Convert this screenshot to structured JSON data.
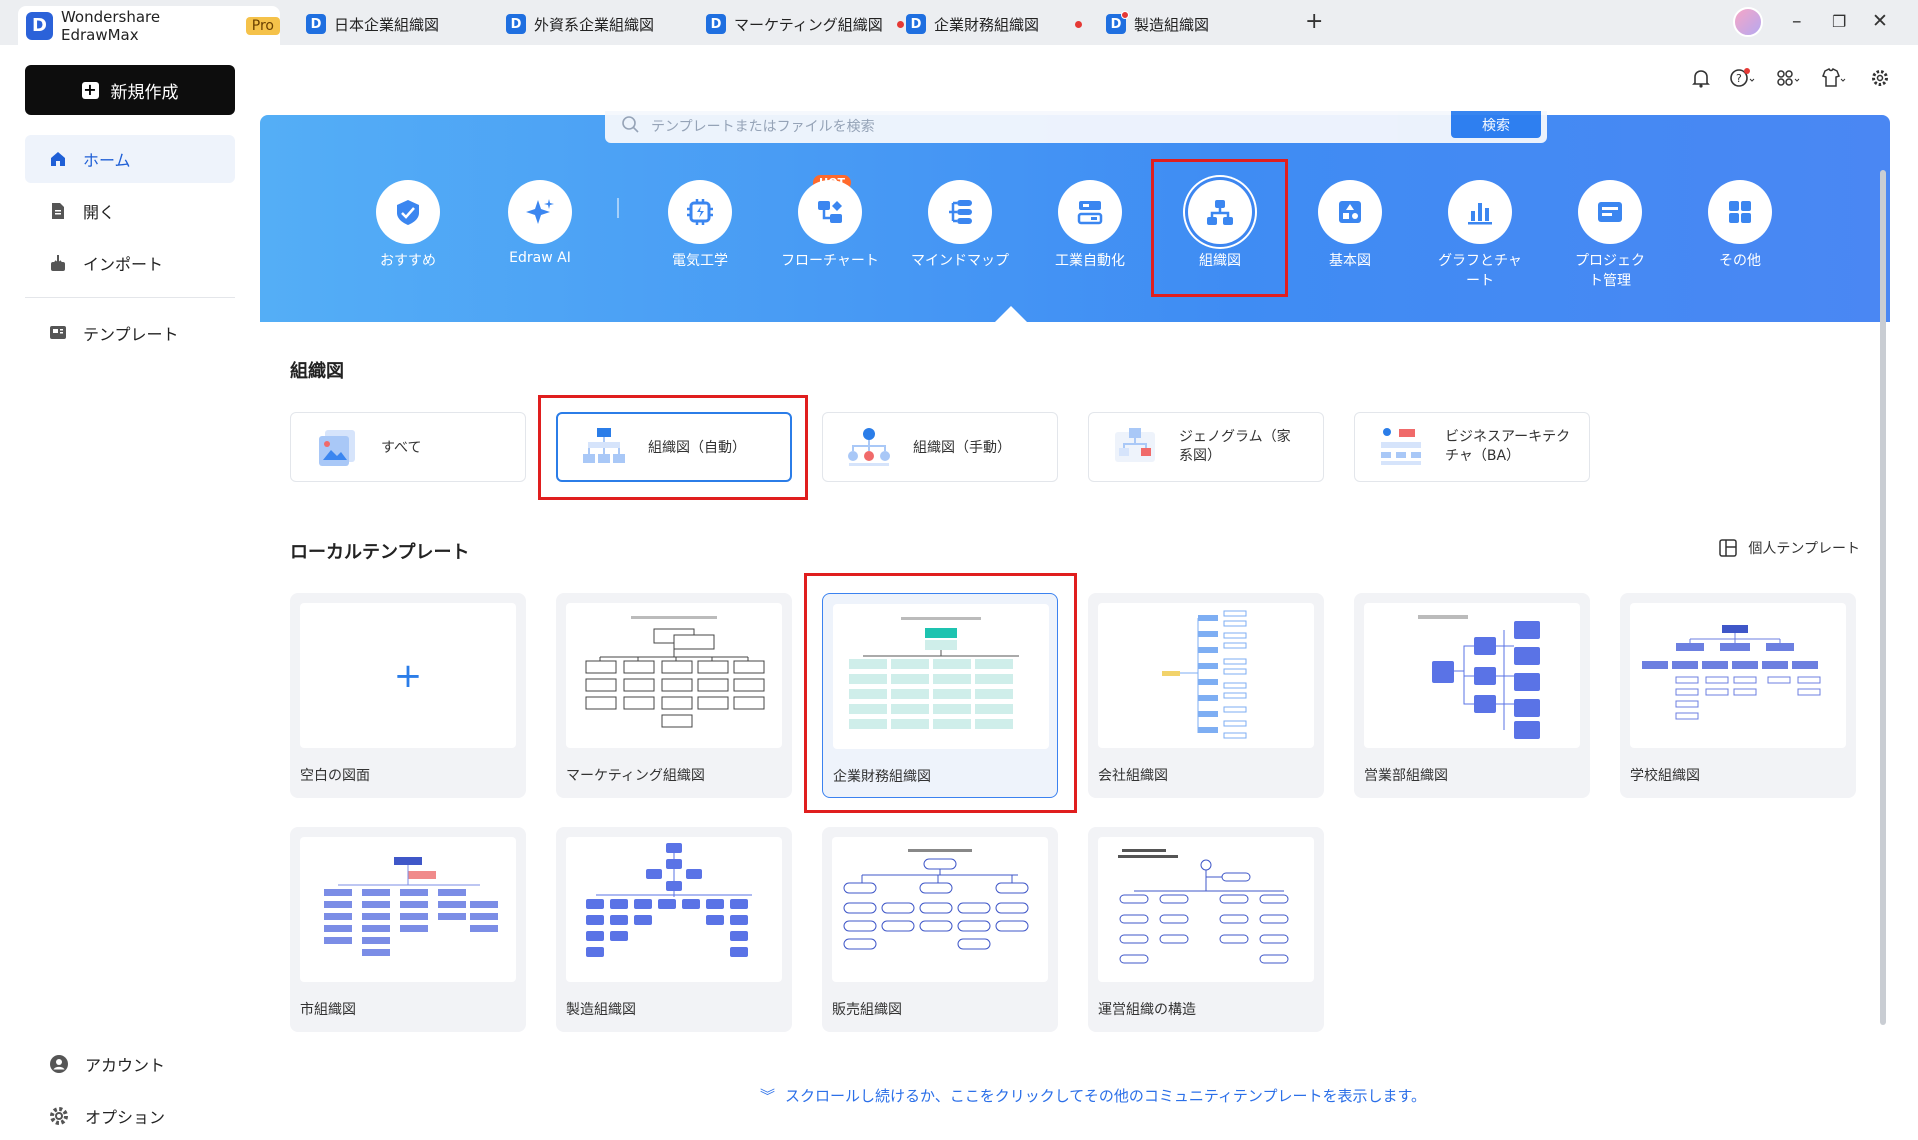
{
  "app": {
    "name": "Wondershare EdrawMax",
    "badge": "Pro"
  },
  "tabs": [
    {
      "label": "日本企業組織図",
      "modified": false
    },
    {
      "label": "外資系企業組織図",
      "modified": false
    },
    {
      "label": "マーケティング組織図",
      "modified": true
    },
    {
      "label": "企業財務組織図",
      "modified": true
    },
    {
      "label": "製造組織図",
      "modified": false
    }
  ],
  "sidebar": {
    "new_label": "新規作成",
    "items": [
      {
        "label": "ホーム",
        "icon": "home-icon",
        "active": true
      },
      {
        "label": "開く",
        "icon": "file-icon",
        "active": false
      },
      {
        "label": "インポート",
        "icon": "import-icon",
        "active": false
      },
      {
        "label": "テンプレート",
        "icon": "template-icon",
        "active": false
      }
    ],
    "bottom": [
      {
        "label": "アカウント",
        "icon": "account-icon"
      },
      {
        "label": "オプション",
        "icon": "gear-icon"
      }
    ]
  },
  "search": {
    "placeholder": "テンプレートまたはファイルを検索",
    "button": "検索"
  },
  "categories": [
    {
      "label": "おすすめ",
      "icon": "recommend-icon"
    },
    {
      "label": "Edraw AI",
      "icon": "ai-sparkle-icon",
      "badge": "HOT"
    },
    {
      "label": "電気工学",
      "icon": "electrical-icon"
    },
    {
      "label": "フローチャート",
      "icon": "flowchart-icon"
    },
    {
      "label": "マインドマップ",
      "icon": "mindmap-icon"
    },
    {
      "label": "工業自動化",
      "icon": "automation-icon"
    },
    {
      "label": "組織図",
      "icon": "org-chart-icon",
      "selected": true
    },
    {
      "label": "基本図",
      "icon": "basic-diagram-icon"
    },
    {
      "label": "グラフとチャート",
      "icon": "chart-icon"
    },
    {
      "label": "プロジェクト管理",
      "icon": "project-icon"
    },
    {
      "label": "その他",
      "icon": "more-grid-icon"
    }
  ],
  "section_title": "組織図",
  "subcategories": [
    {
      "label": "すべて",
      "selected": false
    },
    {
      "label": "組織図（自動）",
      "selected": true
    },
    {
      "label": "組織図（手動）",
      "selected": false
    },
    {
      "label": "ジェノグラム（家系図）",
      "selected": false
    },
    {
      "label": "ビジネスアーキテクチャ（BA）",
      "selected": false
    }
  ],
  "local_templates": {
    "title": "ローカルテンプレート",
    "personal_label": "個人テンプレート",
    "items": [
      {
        "label": "空白の図面",
        "kind": "blank"
      },
      {
        "label": "マーケティング組織図",
        "kind": "marketing"
      },
      {
        "label": "企業財務組織図",
        "kind": "finance",
        "selected": true
      },
      {
        "label": "会社組織図",
        "kind": "company"
      },
      {
        "label": "営業部組織図",
        "kind": "sales-dept"
      },
      {
        "label": "学校組織図",
        "kind": "school"
      },
      {
        "label": "市組織図",
        "kind": "city"
      },
      {
        "label": "製造組織図",
        "kind": "manufacturing"
      },
      {
        "label": "販売組織図",
        "kind": "sales"
      },
      {
        "label": "運営組織の構造",
        "kind": "admin"
      }
    ]
  },
  "more_link": "スクロールし続けるか、ここをクリックしてその他のコミュニティテンプレートを表示します。",
  "colors": {
    "accent": "#2b7de8",
    "banner": "#4a97f4",
    "highlight": "#e01e1e"
  }
}
